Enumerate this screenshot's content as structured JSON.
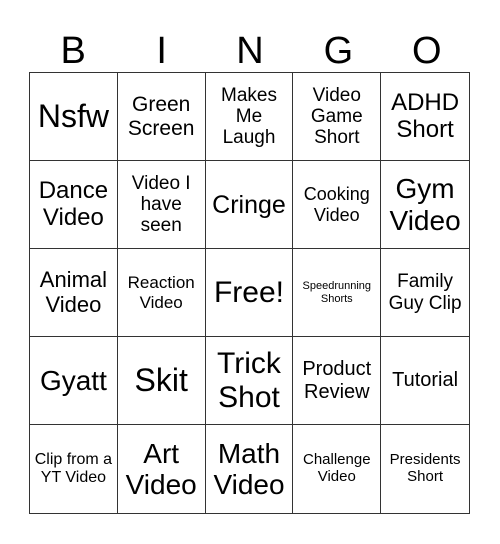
{
  "title_letters": [
    "B",
    "I",
    "N",
    "G",
    "O"
  ],
  "cells": [
    {
      "text": "Nsfw",
      "size": 32
    },
    {
      "text": "Green Screen",
      "size": 21
    },
    {
      "text": "Makes Me Laugh",
      "size": 19
    },
    {
      "text": "Video Game Short",
      "size": 19
    },
    {
      "text": "ADHD Short",
      "size": 24
    },
    {
      "text": "Dance Video",
      "size": 24
    },
    {
      "text": "Video I have seen",
      "size": 19
    },
    {
      "text": "Cringe",
      "size": 25
    },
    {
      "text": "Cooking Video",
      "size": 18
    },
    {
      "text": "Gym Video",
      "size": 28
    },
    {
      "text": "Animal Video",
      "size": 22
    },
    {
      "text": "Reaction Video",
      "size": 17
    },
    {
      "text": "Free!",
      "size": 30
    },
    {
      "text": "Speedrunning Shorts",
      "size": 11
    },
    {
      "text": "Family Guy Clip",
      "size": 19
    },
    {
      "text": "Gyatt",
      "size": 28
    },
    {
      "text": "Skit",
      "size": 32
    },
    {
      "text": "Trick Shot",
      "size": 30
    },
    {
      "text": "Product Review",
      "size": 20
    },
    {
      "text": "Tutorial",
      "size": 20
    },
    {
      "text": "Clip from a YT Video",
      "size": 16
    },
    {
      "text": "Art Video",
      "size": 28
    },
    {
      "text": "Math Video",
      "size": 28
    },
    {
      "text": "Challenge Video",
      "size": 15
    },
    {
      "text": "Presidents Short",
      "size": 15
    }
  ]
}
